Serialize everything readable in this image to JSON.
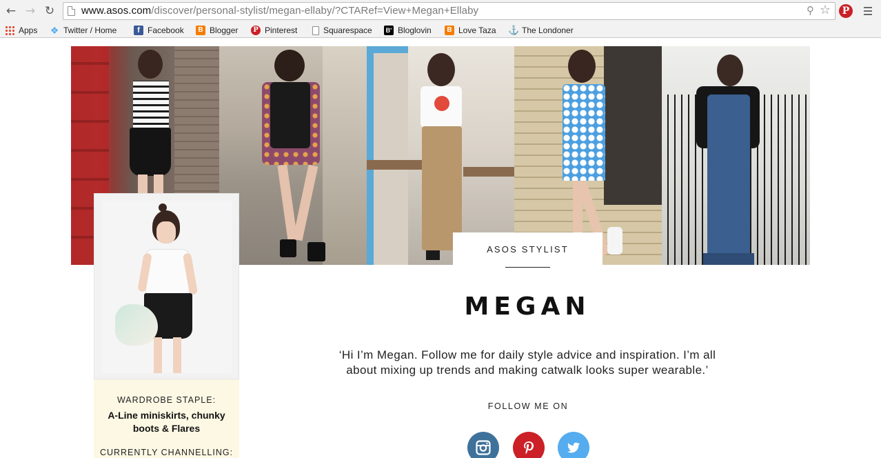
{
  "browser": {
    "url_host": "www.asos.com",
    "url_path": "/discover/personal-stylist/megan-ellaby/?CTARef=View+Megan+Ellaby",
    "colors": {
      "chrome": "#f2f2f2",
      "pinterest": "#cb2027"
    }
  },
  "bookmarks": [
    {
      "label": "Apps",
      "icon": "apps-grid-icon"
    },
    {
      "label": "Twitter / Home",
      "icon": "twitter-bird-icon"
    },
    {
      "label": "Facebook",
      "icon": "facebook-icon"
    },
    {
      "label": "Blogger",
      "icon": "blogger-icon"
    },
    {
      "label": "Pinterest",
      "icon": "pinterest-icon"
    },
    {
      "label": "Squarespace",
      "icon": "page-icon"
    },
    {
      "label": "Bloglovin",
      "icon": "bloglovin-icon"
    },
    {
      "label": "Love Taza",
      "icon": "blogger-icon"
    },
    {
      "label": "The Londoner",
      "icon": "anchor-icon"
    }
  ],
  "page": {
    "stylist_tag": "ASOS STYLIST",
    "name": "MEGAN",
    "bio": "‘Hi I’m Megan. Follow me for daily style advice and inspiration. I’m all about mixing up trends and making catwalk looks super wearable.’",
    "follow_label": "FOLLOW ME ON",
    "wardrobe_staple_label": "WARDROBE STAPLE:",
    "wardrobe_staple_value": "A-Line miniskirts, chunky boots & Flares",
    "currently_channelling_label": "CURRENTLY CHANNELLING:",
    "social": [
      {
        "name": "instagram",
        "icon": "instagram-icon",
        "color": "#3f729b"
      },
      {
        "name": "pinterest",
        "icon": "pinterest-icon",
        "color": "#cb2027"
      },
      {
        "name": "twitter",
        "icon": "twitter-icon",
        "color": "#55acee"
      }
    ],
    "hero_photos": [
      "outfit-photo-striped-top-black-skirt",
      "outfit-photo-floral-dress-leather-vest",
      "outfit-photo-popcorn-tee-wide-trousers",
      "outfit-photo-blue-floral-shift-dress",
      "outfit-photo-leather-jacket-denim-jumpsuit"
    ]
  }
}
